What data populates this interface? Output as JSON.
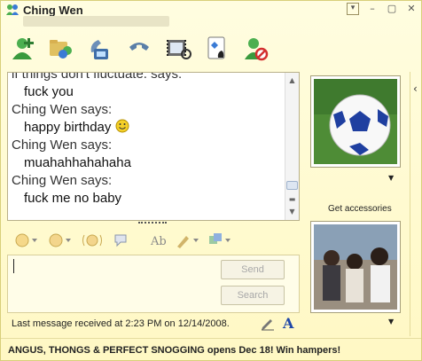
{
  "window": {
    "title": "Ching Wen",
    "controls": [
      "menu",
      "minimize",
      "maximize",
      "close"
    ]
  },
  "toolbar": {
    "icons": [
      "add-contact-icon",
      "share-files-icon",
      "video-call-icon",
      "call-icon",
      "activities-icon",
      "games-icon",
      "block-icon"
    ]
  },
  "chat": {
    "lines": [
      {
        "kind": "who",
        "text": "if things don't fluctuate. says:"
      },
      {
        "kind": "msg",
        "text": "fuck you"
      },
      {
        "kind": "who",
        "text": "Ching Wen says:"
      },
      {
        "kind": "msg",
        "text": "happy birthday"
      },
      {
        "kind": "who",
        "text": "Ching Wen says:"
      },
      {
        "kind": "msg",
        "text": "muahahhahahaha"
      },
      {
        "kind": "who",
        "text": "Ching Wen says:"
      },
      {
        "kind": "msg",
        "text": "fuck me no baby"
      }
    ]
  },
  "format_toolbar": {
    "icons": [
      "emoticon-icon",
      "wink-icon",
      "nudge-icon",
      "voice-clip-icon",
      "font-icon",
      "background-icon",
      "handwriting-icon"
    ]
  },
  "compose": {
    "send_label": "Send",
    "search_label": "Search"
  },
  "status": {
    "last_message": "Last message received at 2:23 PM on 12/14/2008."
  },
  "ad": {
    "text": "ANGUS, THONGS & PERFECT SNOGGING opens Dec 18! Win hampers!"
  },
  "sidebar": {
    "get_accessories": "Get accessories"
  },
  "colors": {
    "window_bg": "#fff8c4",
    "accent": "#1f46a8"
  }
}
